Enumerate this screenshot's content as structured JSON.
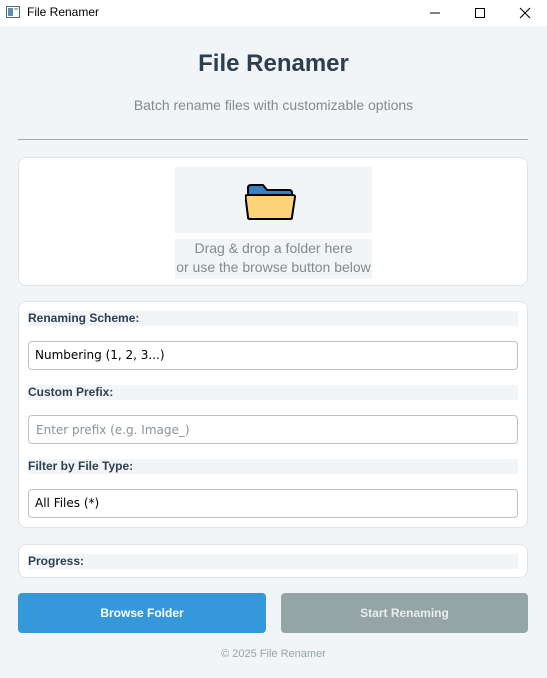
{
  "window": {
    "title": "File Renamer",
    "icons": {
      "app": "app-icon",
      "minimize": "minimize-icon",
      "maximize": "maximize-icon",
      "close": "close-icon"
    }
  },
  "header": {
    "title": "File Renamer",
    "subtitle": "Batch rename files with customizable options"
  },
  "dropzone": {
    "icon": "folder-icon",
    "line1": "Drag & drop a folder here",
    "line2": "or use the browse button below"
  },
  "settings": {
    "scheme_label": "Renaming Scheme:",
    "scheme_value": "Numbering (1, 2, 3...)",
    "prefix_label": "Custom Prefix:",
    "prefix_value": "",
    "prefix_placeholder": "Enter prefix (e.g. Image_)",
    "filter_label": "Filter by File Type:",
    "filter_value": "All Files (*)"
  },
  "progress": {
    "label": "Progress:"
  },
  "buttons": {
    "browse": "Browse Folder",
    "start": "Start Renaming"
  },
  "footer": {
    "text": "© 2025 File Renamer"
  },
  "colors": {
    "background": "#f2f5f8",
    "primary": "#3498db",
    "disabled": "#95a5a6",
    "title_text": "#2c3e50",
    "muted_text": "#7f8c8d"
  }
}
